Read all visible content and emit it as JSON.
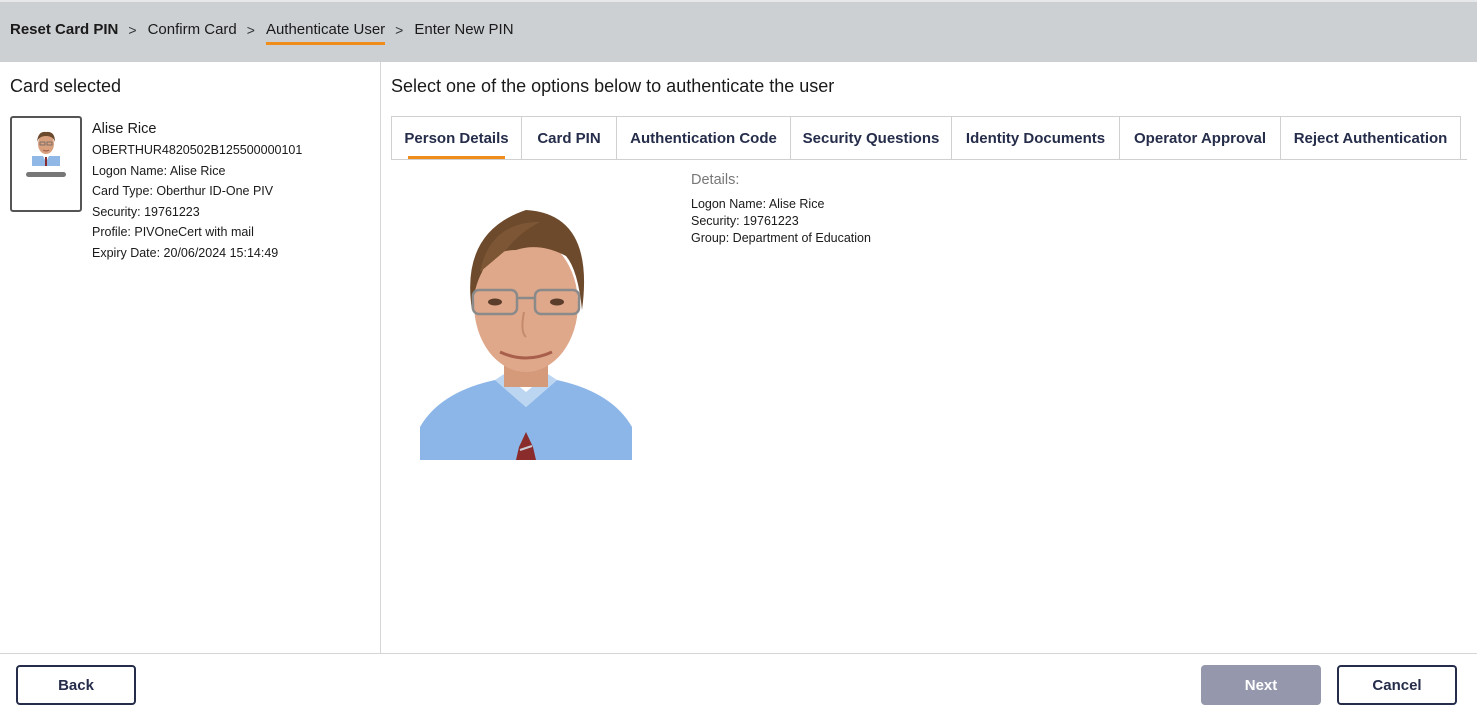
{
  "breadcrumb": {
    "items": [
      "Reset Card PIN",
      "Confirm Card",
      "Authenticate User",
      "Enter New PIN"
    ],
    "separator": ">",
    "active_index": 2
  },
  "left": {
    "title": "Card selected",
    "card": {
      "name": "Alise Rice",
      "serial": "OBERTHUR4820502B125500000101",
      "logon": "Logon Name: Alise Rice",
      "type": "Card Type: Oberthur ID-One PIV",
      "security": "Security: 19761223",
      "profile": "Profile: PIVOneCert with mail",
      "expiry": "Expiry Date: 20/06/2024 15:14:49"
    }
  },
  "main": {
    "title": "Select one of the options below to authenticate the user",
    "tabs": [
      {
        "label": "Person Details",
        "active": true
      },
      {
        "label": "Card PIN"
      },
      {
        "label": "Authentication Code"
      },
      {
        "label": "Security Questions"
      },
      {
        "label": "Identity Documents"
      },
      {
        "label": "Operator Approval"
      },
      {
        "label": "Reject Authentication"
      }
    ],
    "details": {
      "heading": "Details:",
      "logon": "Logon Name: Alise Rice",
      "security": "Security: 19761223",
      "group": "Group: Department of Education"
    }
  },
  "footer": {
    "back_label": "Back",
    "next_label": "Next",
    "cancel_label": "Cancel"
  },
  "colors": {
    "accent": "#f08c1a",
    "primary_text": "#252d4a",
    "topbar": "#ccd0d3",
    "disabled_button": "#9598ad"
  }
}
